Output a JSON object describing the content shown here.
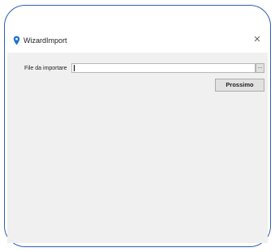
{
  "window": {
    "title": "WizardImport",
    "close_glyph": "✕",
    "icon": "pin-icon",
    "accent_color": "#1e73d2"
  },
  "form": {
    "file_label": "File da importare",
    "file_value": "",
    "browse_label": "...",
    "next_label": "Prossimo"
  }
}
